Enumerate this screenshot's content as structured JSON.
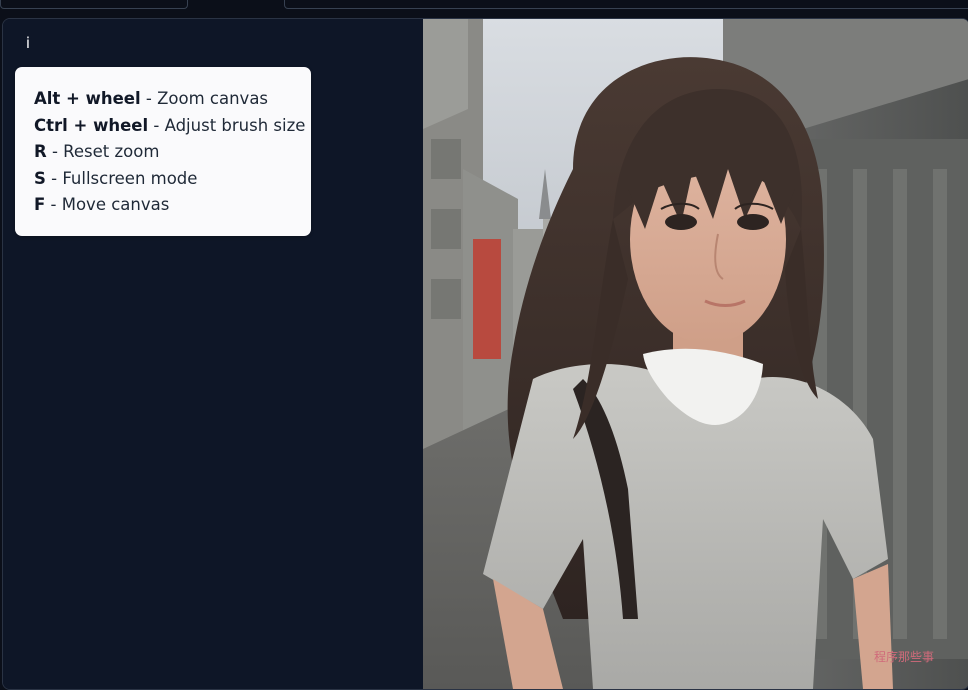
{
  "shortcuts_tooltip": {
    "info_label": "i",
    "items": [
      {
        "key": "Alt + wheel",
        "desc": " - Zoom canvas"
      },
      {
        "key": "Ctrl + wheel",
        "desc": " - Adjust brush size"
      },
      {
        "key": "R",
        "desc": " - Reset zoom"
      },
      {
        "key": "S",
        "desc": " - Fullscreen mode"
      },
      {
        "key": "F",
        "desc": " - Move canvas"
      }
    ]
  },
  "image": {
    "description_icon": "portrait-photo",
    "mask_color": "#f2f2f0"
  },
  "watermark": {
    "text": "程序那些事"
  }
}
